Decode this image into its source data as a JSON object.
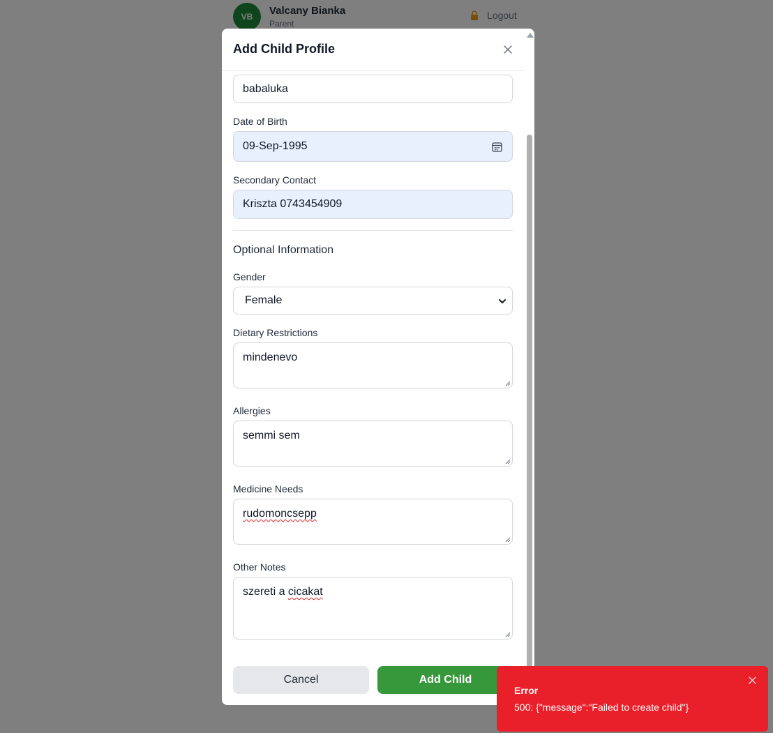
{
  "header": {
    "avatar_initials": "VB",
    "user_name": "Valcany Bianka",
    "user_role": "Parent",
    "logout_label": "Logout"
  },
  "modal": {
    "title": "Add Child Profile",
    "name_value": "babaluka",
    "dob_label": "Date of Birth",
    "dob_value": "09-Sep-1995",
    "secondary_contact_label": "Secondary Contact",
    "secondary_contact_value": "Kriszta 0743454909",
    "optional_section_title": "Optional Information",
    "gender_label": "Gender",
    "gender_value": "Female",
    "dietary_label": "Dietary Restrictions",
    "dietary_value": "mindenevo",
    "allergies_label": "Allergies",
    "allergies_value": "semmi sem",
    "medicine_label": "Medicine Needs",
    "medicine_value": "rudomoncsepp",
    "notes_label": "Other Notes",
    "notes_value_plain": "szereti a ",
    "notes_value_misspelled": "cicakat",
    "cancel_label": "Cancel",
    "add_label": "Add Child"
  },
  "toast": {
    "title": "Error",
    "message": "500: {\"message\":\"Failed to create child\"}",
    "color": "#e9202a"
  },
  "colors": {
    "accent": "#37983b",
    "autofill_bg": "#e8f0fe"
  }
}
